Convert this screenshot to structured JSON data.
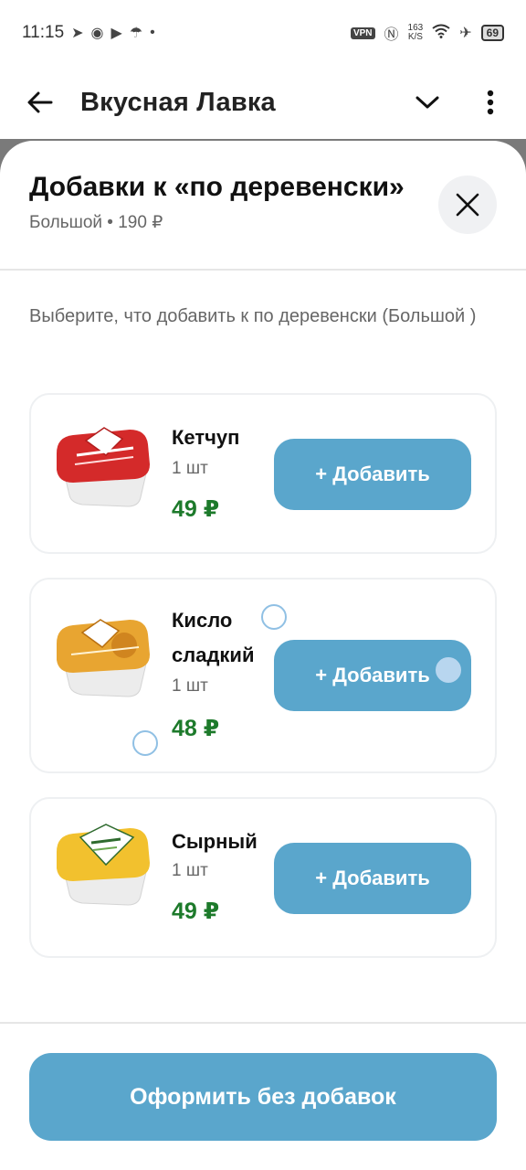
{
  "status_bar": {
    "time": "11:15",
    "icons": [
      "telegram-icon",
      "chat-icon",
      "youtube-icon",
      "umbrella-icon",
      "dot-icon"
    ],
    "vpn": "VPN",
    "speed_value": "163",
    "speed_unit": "K/S",
    "battery": "69"
  },
  "app_bar": {
    "title": "Вкусная Лавка",
    "back_icon": "arrow-left-icon",
    "dropdown_icon": "chevron-down-icon",
    "menu_icon": "more-vertical-icon"
  },
  "sheet": {
    "title": "Добавки к «по деревенски»",
    "subtitle": "Большой • 190 ₽",
    "description": "Выберите, что добавить к по деревенски (Большой )",
    "items": [
      {
        "name": "Кетчуп",
        "qty": "1 шт",
        "price": "49 ₽",
        "button": "+ Добавить",
        "color": "#d42a2a"
      },
      {
        "name": "Кисло сладкий",
        "qty": "1 шт",
        "price": "48 ₽",
        "button": "+ Добавить",
        "color": "#e8a531"
      },
      {
        "name": "Сырный",
        "qty": "1 шт",
        "price": "49 ₽",
        "button": "+ Добавить",
        "color": "#f2c12e"
      }
    ],
    "checkout_button": "Оформить без добавок"
  },
  "colors": {
    "accent": "#5aa6cc",
    "price": "#1d7a2b"
  }
}
